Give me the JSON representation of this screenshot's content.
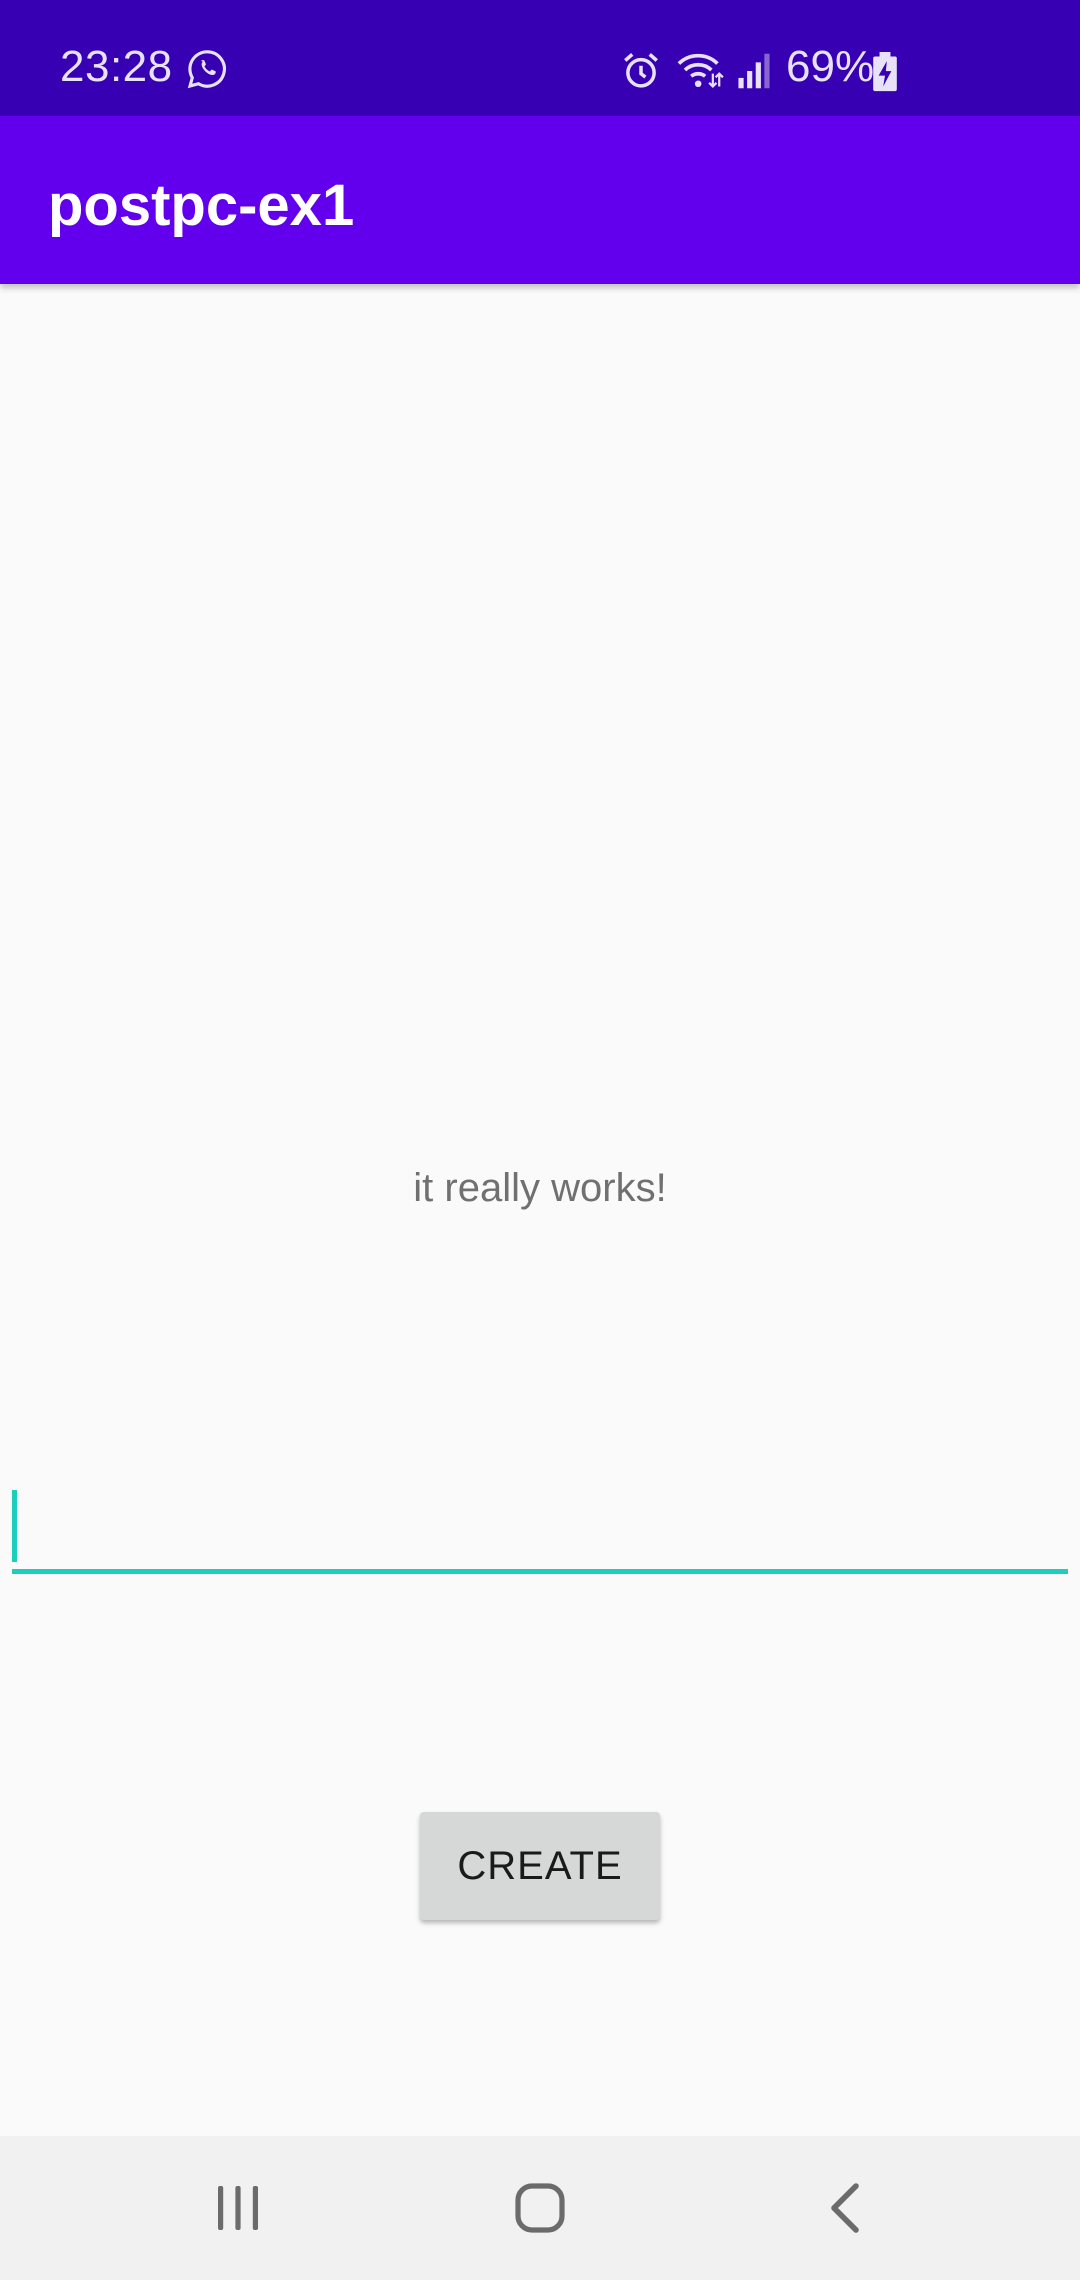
{
  "status_bar": {
    "time": "23:28",
    "battery_percent": "69%",
    "icons": [
      "whatsapp-icon",
      "alarm-icon",
      "wifi-icon",
      "signal-icon",
      "battery-charging-icon"
    ]
  },
  "app_bar": {
    "title": "postpc-ex1"
  },
  "main": {
    "message": "it really works!",
    "input": {
      "value": "",
      "placeholder": ""
    },
    "create_button_label": "CREATE"
  },
  "nav_bar": {
    "icons": [
      "recents-icon",
      "home-icon",
      "back-icon"
    ]
  },
  "colors": {
    "status_bar": "#3700b3",
    "app_bar": "#6200ee",
    "accent": "#1ccfbd",
    "background": "#fafafa",
    "button": "#d6d7d7"
  }
}
